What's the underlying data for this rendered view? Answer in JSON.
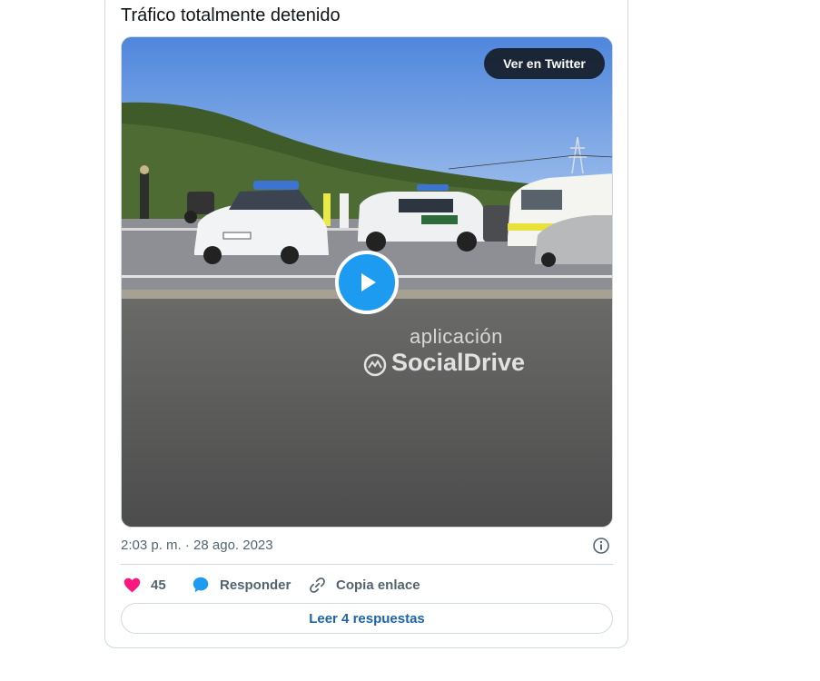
{
  "tweet": {
    "text": "Tráfico totalmente detenido",
    "timestamp": "2:03 p. m. · 28 ago. 2023"
  },
  "media": {
    "view_on_twitter_label": "Ver en Twitter",
    "watermark_line1": "aplicación",
    "watermark_line2": "SocialDrive",
    "icons": {
      "play": "play-icon",
      "watermark": "socialdrive-logo-icon"
    }
  },
  "actions": {
    "like_count": "45",
    "reply_label": "Responder",
    "copy_label": "Copia enlace",
    "icons": {
      "like": "heart-icon",
      "reply": "speech-bubble-icon",
      "copy": "link-icon",
      "info": "info-icon"
    }
  },
  "read_replies_label": "Leer 4 respuestas",
  "colors": {
    "accent": "#1d9bf0",
    "like": "#f91880",
    "link_text": "#1d64a7",
    "secondary_text": "#536471",
    "border": "#cfd9de"
  }
}
